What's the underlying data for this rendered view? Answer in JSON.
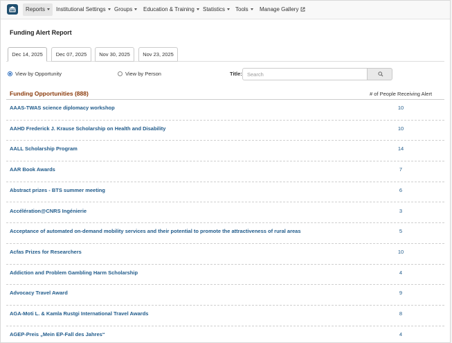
{
  "nav": {
    "items": [
      {
        "label": "Reports",
        "caret": true,
        "active": true
      },
      {
        "label": "Institutional Settings",
        "caret": true
      },
      {
        "label": "Groups",
        "caret": true
      },
      {
        "label": "Education & Training",
        "caret": true
      },
      {
        "label": "Statistics",
        "caret": true
      },
      {
        "label": "Tools",
        "caret": true
      },
      {
        "label": "Manage Gallery",
        "external": true
      }
    ]
  },
  "page": {
    "title": "Funding Alert Report"
  },
  "tabs": [
    {
      "label": "Dec 14, 2025",
      "active": true
    },
    {
      "label": "Dec 07, 2025"
    },
    {
      "label": "Nov 30, 2025"
    },
    {
      "label": "Nov 23, 2025"
    }
  ],
  "view": {
    "by_opportunity": "View by Opportunity",
    "by_person": "View by Person",
    "selected": "by_opportunity"
  },
  "search": {
    "label": "Title:",
    "placeholder": "Search",
    "value": ""
  },
  "list": {
    "title": "Funding Opportunities (888)",
    "count_header": "# of People Receiving Alert",
    "rows": [
      {
        "name": "AAAS-TWAS science diplomacy workshop",
        "count": "10"
      },
      {
        "name": "AAHD Frederick J. Krause Scholarship on Health and Disability",
        "count": "10"
      },
      {
        "name": "AALL Scholarship Program",
        "count": "14"
      },
      {
        "name": "AAR Book Awards",
        "count": "7"
      },
      {
        "name": "Abstract prizes - BTS summer meeting",
        "count": "6"
      },
      {
        "name": "Accélération@CNRS Ingénierie",
        "count": "3"
      },
      {
        "name": "Acceptance of automated on-demand mobility services and their potential to promote the attractiveness of rural areas",
        "count": "5"
      },
      {
        "name": "Acfas Prizes for Researchers",
        "count": "10"
      },
      {
        "name": "Addiction and Problem Gambling Harm Scholarship",
        "count": "4"
      },
      {
        "name": "Advocacy Travel Award",
        "count": "9"
      },
      {
        "name": "AGA-Moti L. & Kamla Rustgi International Travel Awards",
        "count": "8"
      },
      {
        "name": "AGEP-Preis „Mein EP-Fall des Jahres“",
        "count": "4"
      }
    ]
  },
  "colors": {
    "brand": "#1f4e6e",
    "section_title": "#8a3a0a",
    "link": "#1f5a8a",
    "radio_selected": "#2f6fbf"
  },
  "icons": {
    "logo": "building-icon",
    "search": "search-icon",
    "external": "external-link-icon"
  }
}
